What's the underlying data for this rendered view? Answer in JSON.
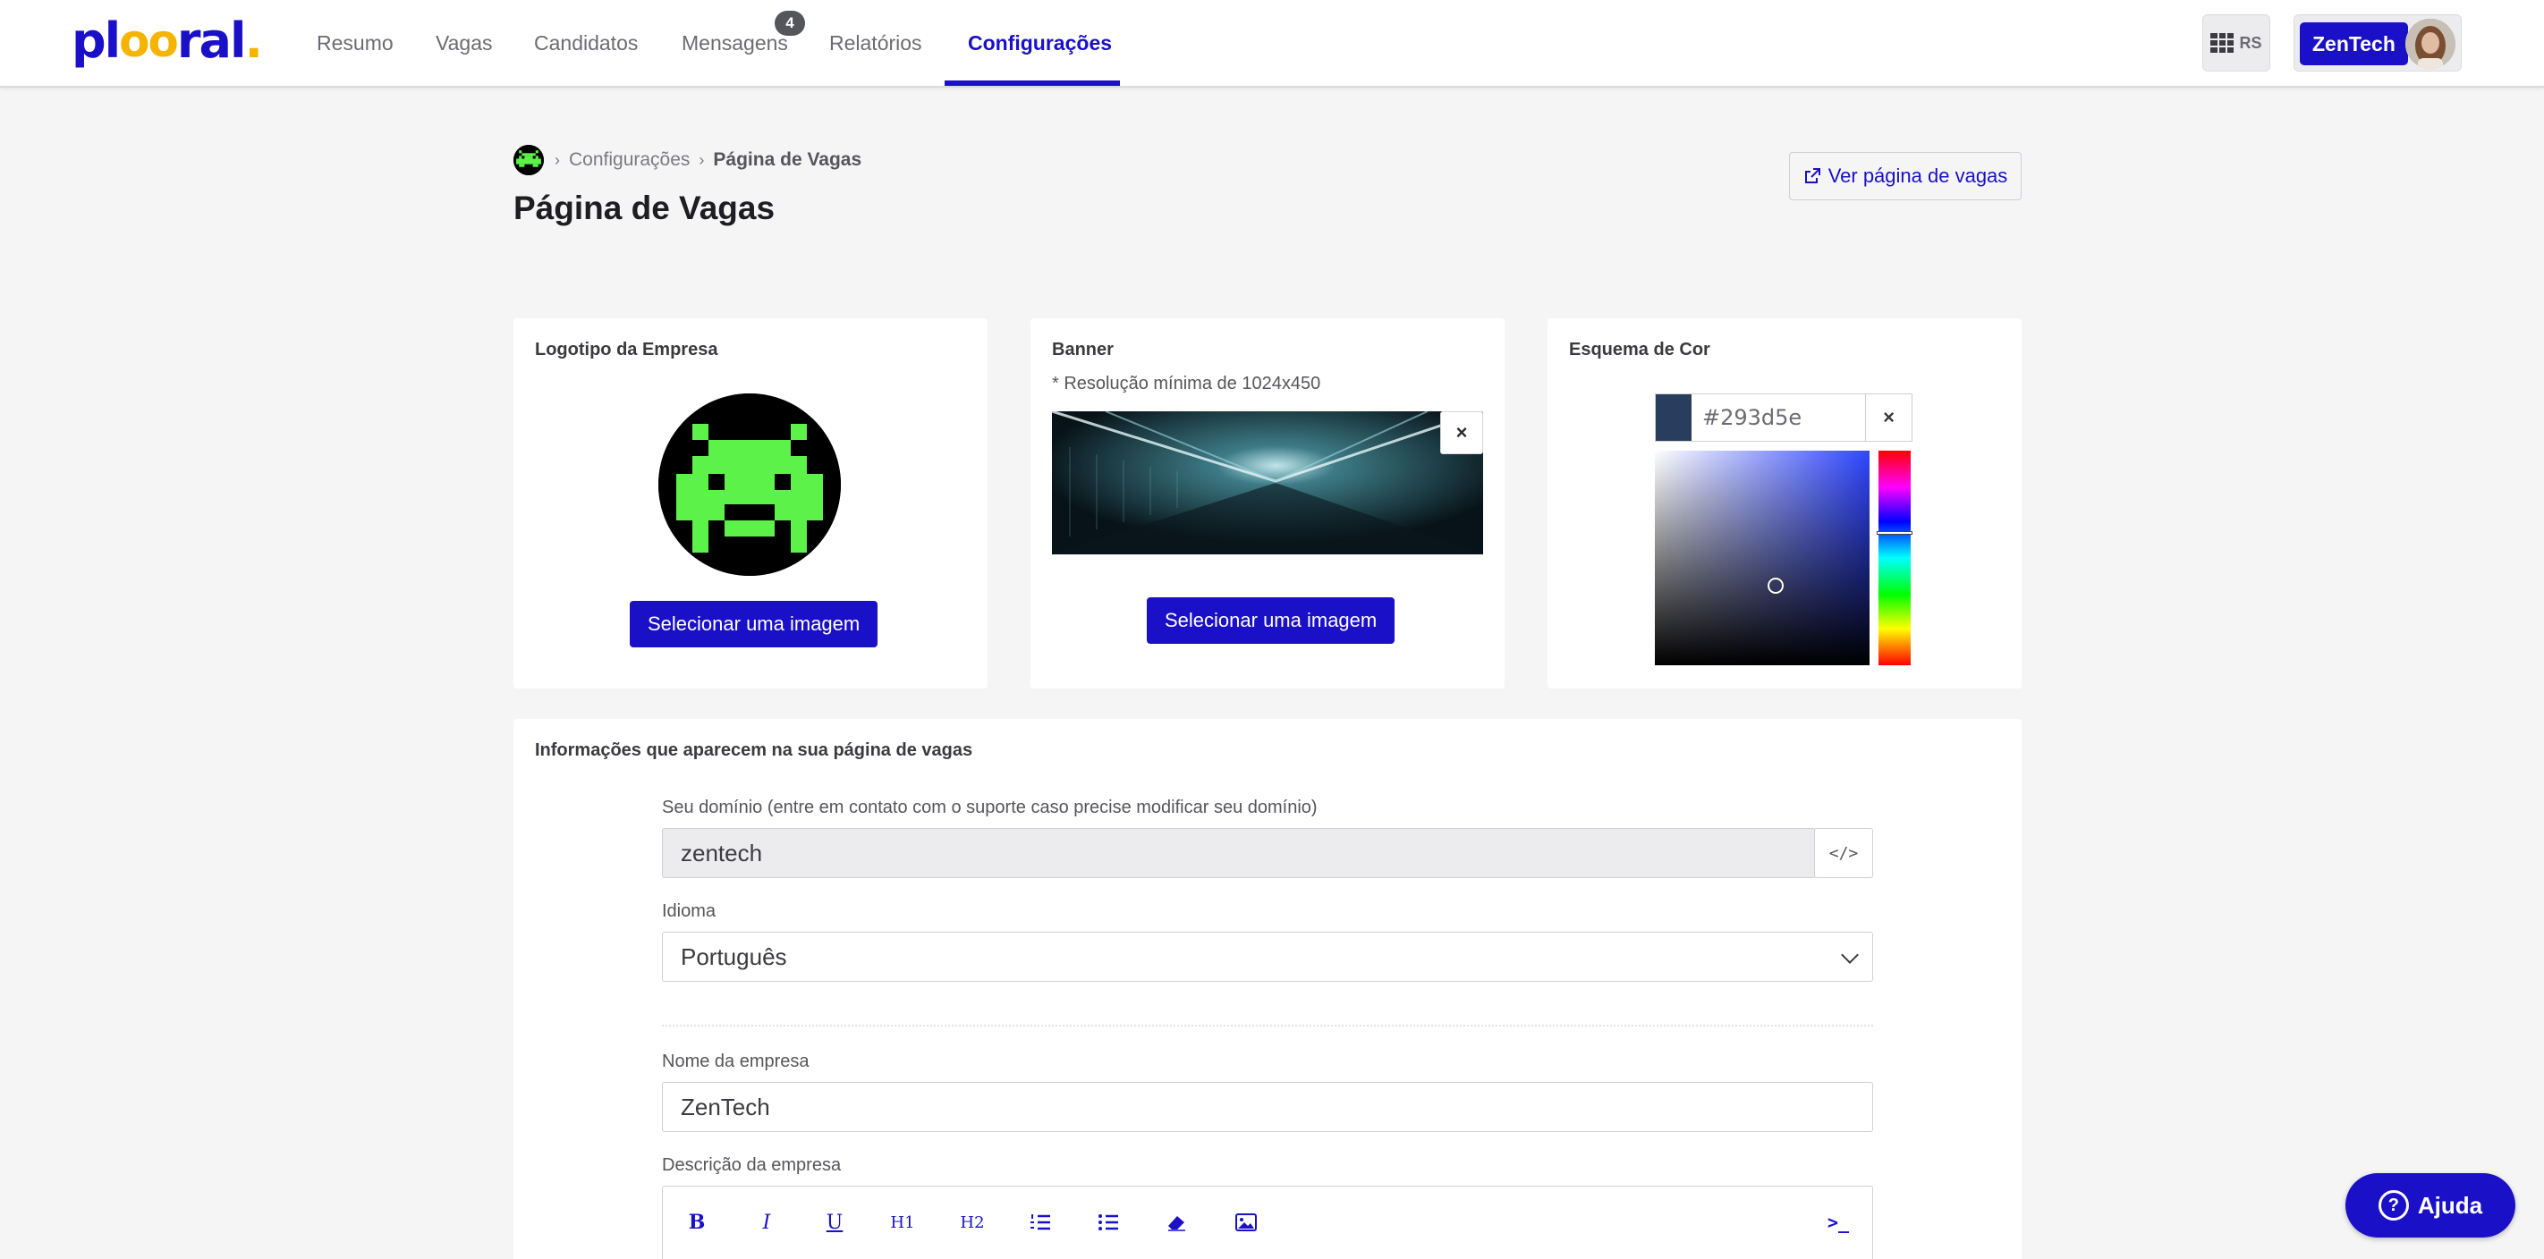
{
  "brand": {
    "logo_text_a": "pl",
    "logo_text_mid": "oo",
    "logo_text_b": "ral",
    "logo_dot": ".",
    "accent_color": "#1a10c8",
    "logo_accent_color": "#f6b400"
  },
  "nav": {
    "items": [
      {
        "label": "Resumo"
      },
      {
        "label": "Vagas"
      },
      {
        "label": "Candidatos"
      },
      {
        "label": "Mensagens",
        "badge": "4"
      },
      {
        "label": "Relatórios"
      },
      {
        "label": "Configurações",
        "active": true
      }
    ],
    "apps_label": "RS",
    "company_button": "ZenTech"
  },
  "breadcrumb": {
    "parent": "Configurações",
    "current": "Página de Vagas"
  },
  "page_title": "Página de Vagas",
  "view_jobs_button": "Ver página de vagas",
  "cards": {
    "logo": {
      "title": "Logotipo da Empresa",
      "button": "Selecionar uma imagem"
    },
    "banner": {
      "title": "Banner",
      "note": "* Resolução mínima de 1024x450",
      "button": "Selecionar uma imagem",
      "close_icon": "×"
    },
    "color": {
      "title": "Esquema de Cor",
      "hex": "#293d5e",
      "swatch_color": "#293d5e",
      "clear_icon": "×"
    }
  },
  "info": {
    "title": "Informações que aparecem na sua página de vagas",
    "domain": {
      "label": "Seu domínio (entre em contato com o suporte caso precise modificar seu domínio)",
      "value": "zentech",
      "code_icon": "</>"
    },
    "language": {
      "label": "Idioma",
      "value": "Português"
    },
    "company_name": {
      "label": "Nome da empresa",
      "value": "ZenTech"
    },
    "company_description": {
      "label": "Descrição da empresa"
    },
    "toolbar": {
      "bold": "B",
      "italic": "I",
      "underline": "U",
      "h1": "H1",
      "h2": "H2",
      "terminal": ">_"
    }
  },
  "help_button": "Ajuda"
}
